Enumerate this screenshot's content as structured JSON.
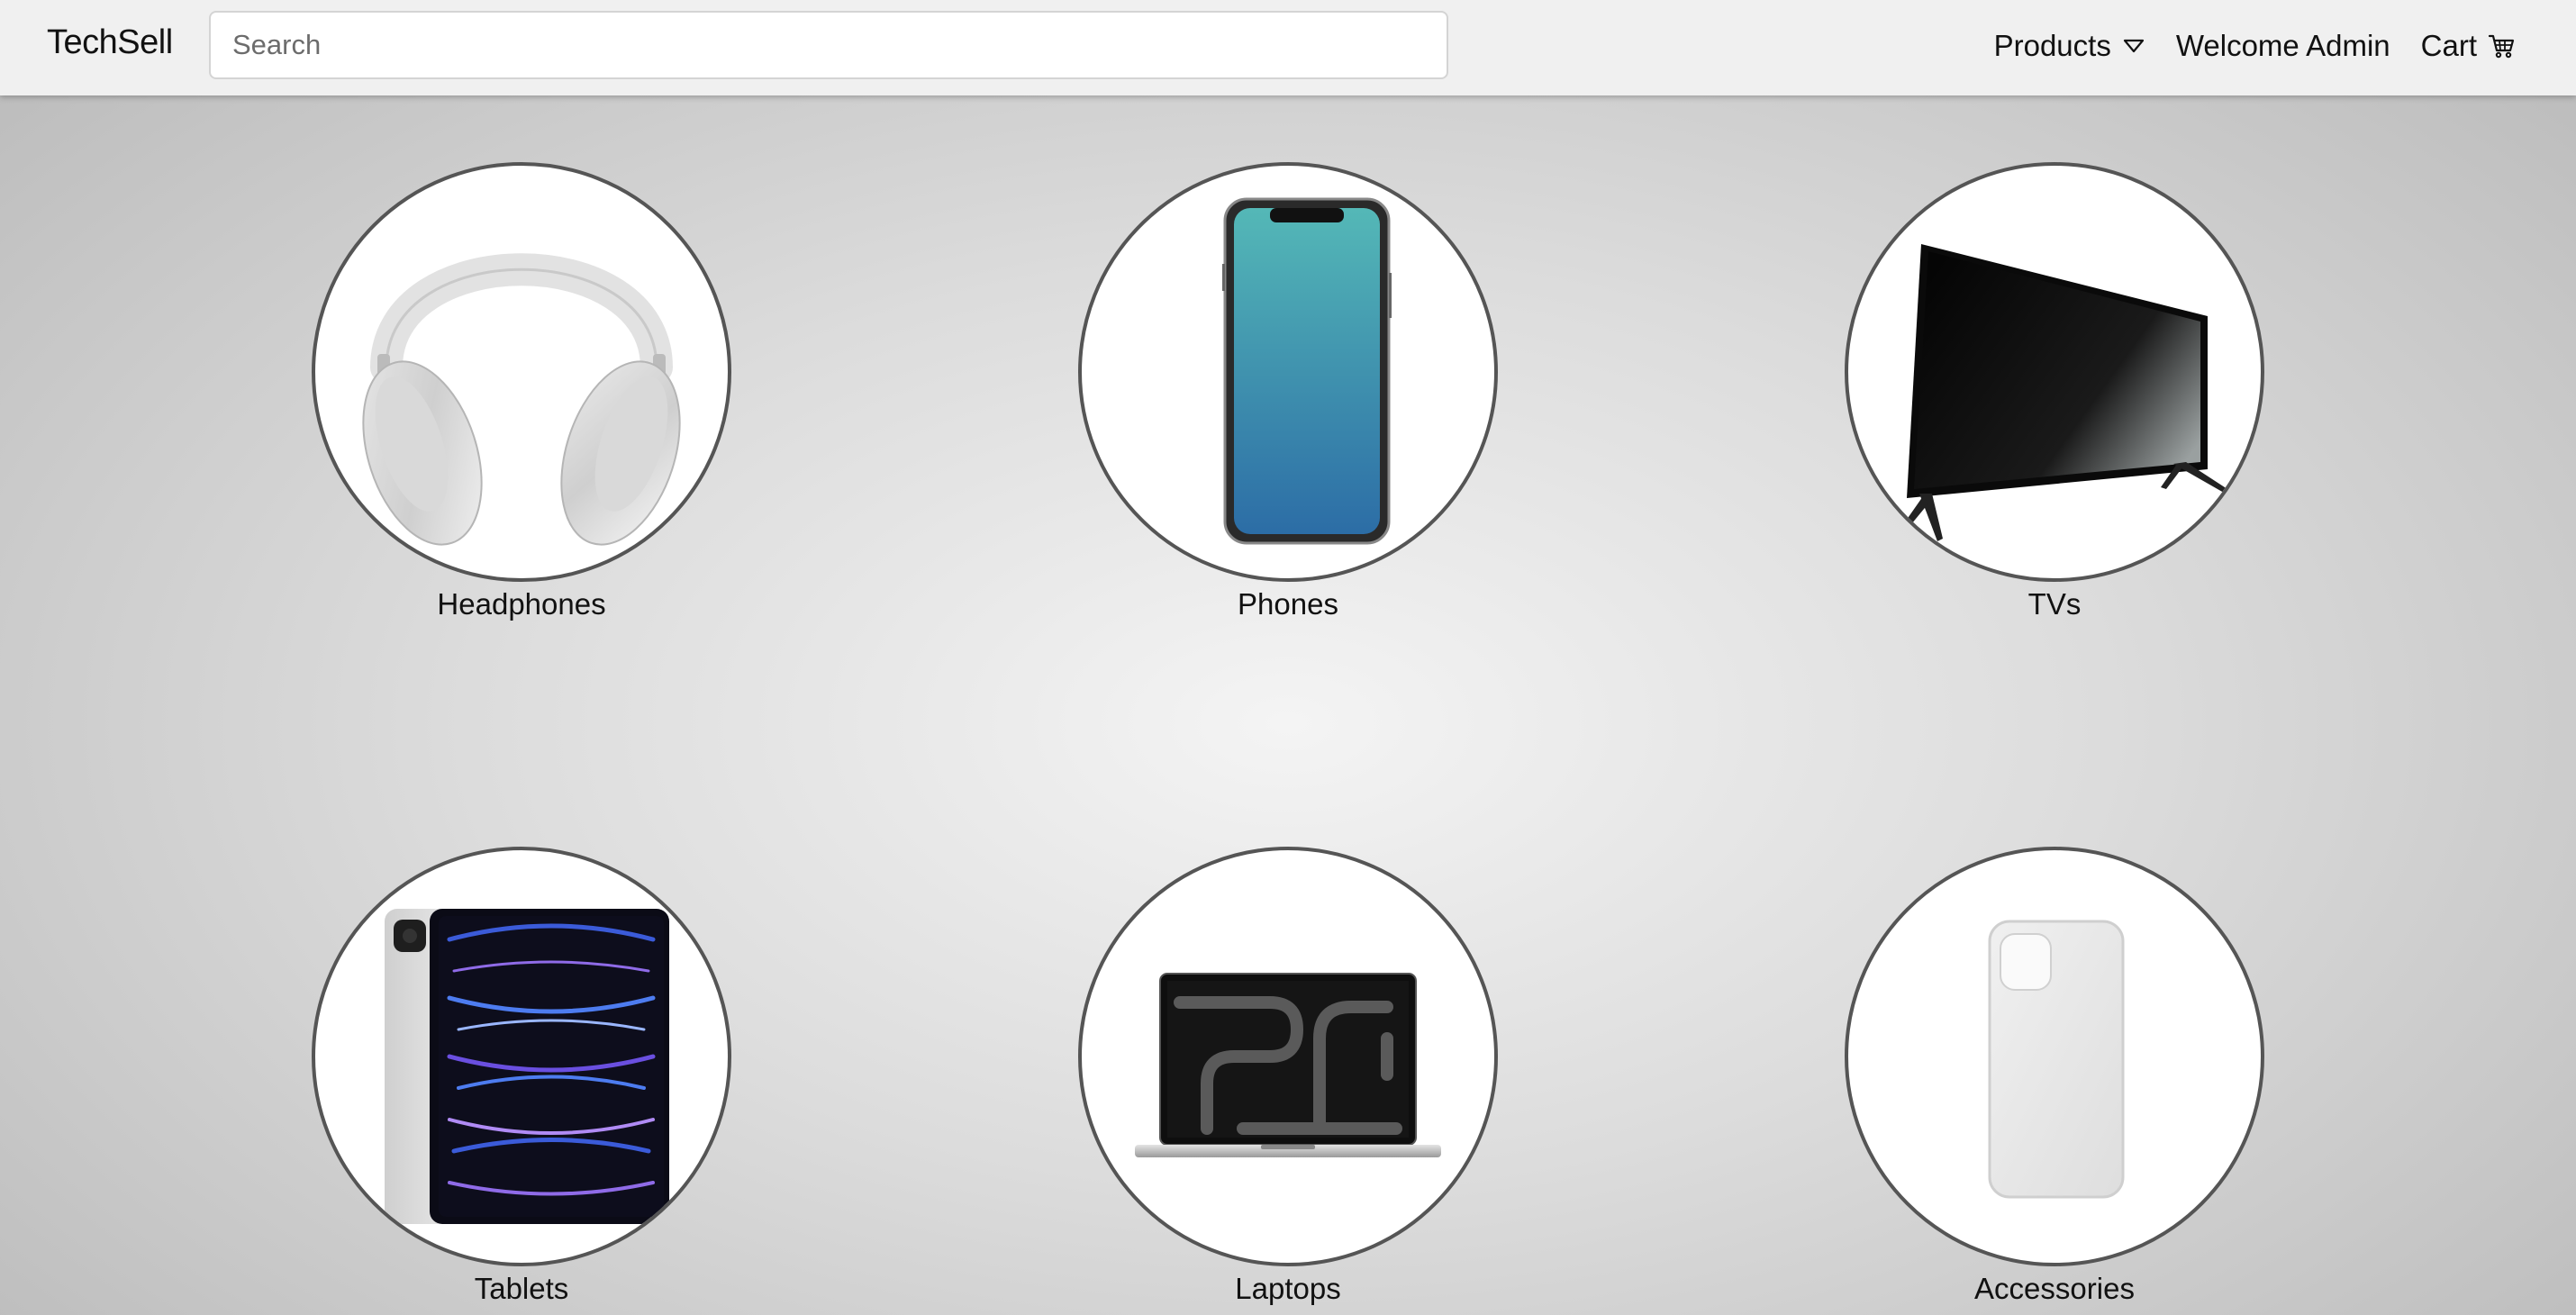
{
  "brand": "TechSell",
  "search": {
    "placeholder": "Search",
    "value": ""
  },
  "nav": {
    "products_label": "Products",
    "welcome_label": "Welcome Admin",
    "cart_label": "Cart",
    "products_icon": "triangle-down-icon",
    "cart_icon": "cart-icon"
  },
  "categories": [
    {
      "label": "Headphones",
      "image": "headphones-image"
    },
    {
      "label": "Phones",
      "image": "phone-image"
    },
    {
      "label": "TVs",
      "image": "tv-image"
    },
    {
      "label": "Tablets",
      "image": "tablet-image"
    },
    {
      "label": "Laptops",
      "image": "laptop-image"
    },
    {
      "label": "Accessories",
      "image": "phone-case-image"
    }
  ],
  "colors": {
    "navbar_bg": "#f0f0f0",
    "circle_border": "#555555",
    "page_bg_center": "#f4f4f4",
    "page_bg_edge": "#b9b9b9"
  }
}
